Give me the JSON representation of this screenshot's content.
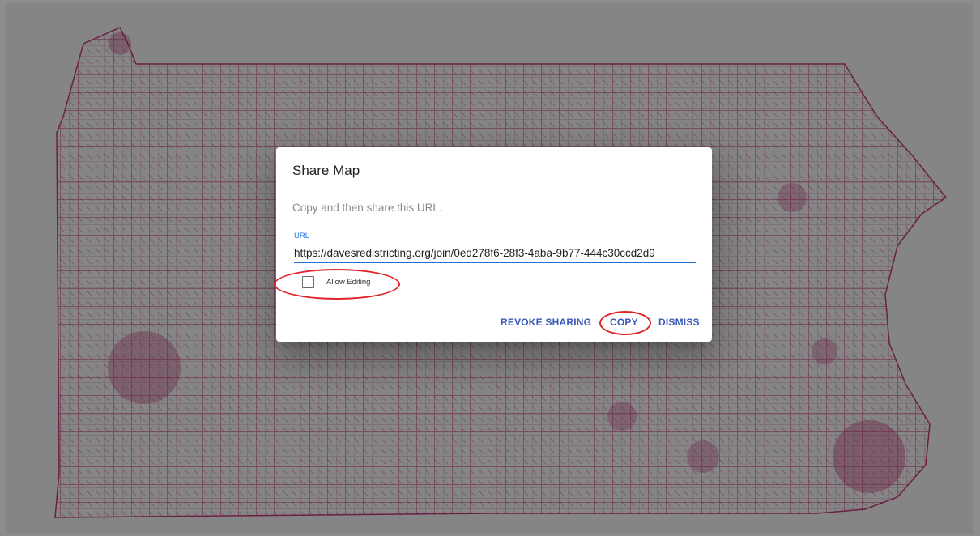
{
  "dialog": {
    "title": "Share Map",
    "description": "Copy and then share this URL.",
    "url_label": "URL",
    "url_value": "https://davesredistricting.org/join/0ed278f6-28f3-4aba-9b77-444c30ccd2d9",
    "checkbox_label": "Allow Editing",
    "checkbox_checked": false,
    "actions": {
      "revoke": "REVOKE SHARING",
      "copy": "COPY",
      "dismiss": "DISMISS"
    }
  },
  "colors": {
    "accent": "#1e73d8",
    "action_text": "#3b5ab8",
    "annotation_red": "#e0242a",
    "boundary_lines": "#6b1f44",
    "overlay_gray": "#8a8a8a"
  }
}
